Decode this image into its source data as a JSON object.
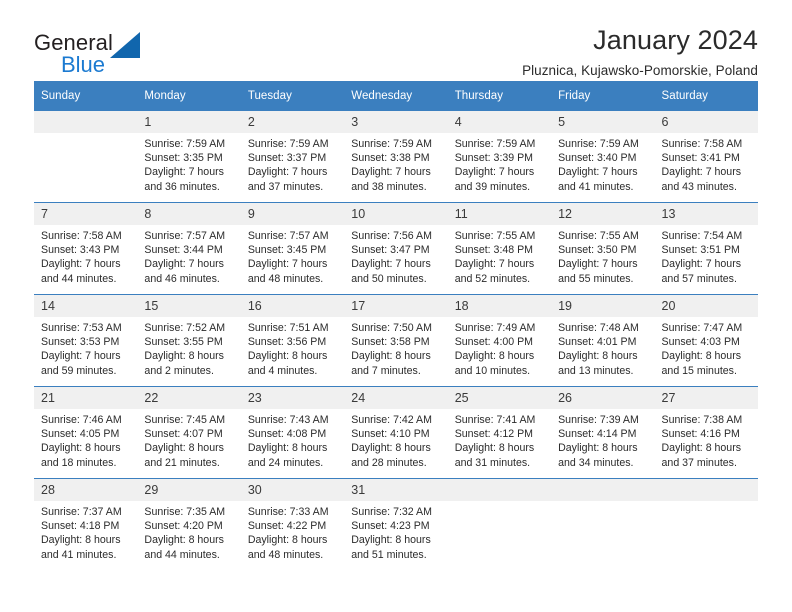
{
  "logo": {
    "word_general": "General",
    "word_blue": "Blue",
    "triangle_color": "#1166ad",
    "blue_text_color": "#1b7ad1"
  },
  "header": {
    "title": "January 2024",
    "subtitle": "Pluznica, Kujawsko-Pomorskie, Poland",
    "header_bg_color": "#3b7fbf",
    "daynum_bg_color": "#f0f0f0"
  },
  "weekday_headers": [
    "Sunday",
    "Monday",
    "Tuesday",
    "Wednesday",
    "Thursday",
    "Friday",
    "Saturday"
  ],
  "labels": {
    "sunrise_prefix": "Sunrise:",
    "sunset_prefix": "Sunset:",
    "daylight_prefix": "Daylight:"
  },
  "weeks": [
    [
      {
        "day": "",
        "blank": true,
        "line1": "",
        "line2": "",
        "line3": "",
        "line4": ""
      },
      {
        "day": "1",
        "line1": "Sunrise: 7:59 AM",
        "line2": "Sunset: 3:35 PM",
        "line3": "Daylight: 7 hours",
        "line4": "and 36 minutes."
      },
      {
        "day": "2",
        "line1": "Sunrise: 7:59 AM",
        "line2": "Sunset: 3:37 PM",
        "line3": "Daylight: 7 hours",
        "line4": "and 37 minutes."
      },
      {
        "day": "3",
        "line1": "Sunrise: 7:59 AM",
        "line2": "Sunset: 3:38 PM",
        "line3": "Daylight: 7 hours",
        "line4": "and 38 minutes."
      },
      {
        "day": "4",
        "line1": "Sunrise: 7:59 AM",
        "line2": "Sunset: 3:39 PM",
        "line3": "Daylight: 7 hours",
        "line4": "and 39 minutes."
      },
      {
        "day": "5",
        "line1": "Sunrise: 7:59 AM",
        "line2": "Sunset: 3:40 PM",
        "line3": "Daylight: 7 hours",
        "line4": "and 41 minutes."
      },
      {
        "day": "6",
        "line1": "Sunrise: 7:58 AM",
        "line2": "Sunset: 3:41 PM",
        "line3": "Daylight: 7 hours",
        "line4": "and 43 minutes."
      }
    ],
    [
      {
        "day": "7",
        "line1": "Sunrise: 7:58 AM",
        "line2": "Sunset: 3:43 PM",
        "line3": "Daylight: 7 hours",
        "line4": "and 44 minutes."
      },
      {
        "day": "8",
        "line1": "Sunrise: 7:57 AM",
        "line2": "Sunset: 3:44 PM",
        "line3": "Daylight: 7 hours",
        "line4": "and 46 minutes."
      },
      {
        "day": "9",
        "line1": "Sunrise: 7:57 AM",
        "line2": "Sunset: 3:45 PM",
        "line3": "Daylight: 7 hours",
        "line4": "and 48 minutes."
      },
      {
        "day": "10",
        "line1": "Sunrise: 7:56 AM",
        "line2": "Sunset: 3:47 PM",
        "line3": "Daylight: 7 hours",
        "line4": "and 50 minutes."
      },
      {
        "day": "11",
        "line1": "Sunrise: 7:55 AM",
        "line2": "Sunset: 3:48 PM",
        "line3": "Daylight: 7 hours",
        "line4": "and 52 minutes."
      },
      {
        "day": "12",
        "line1": "Sunrise: 7:55 AM",
        "line2": "Sunset: 3:50 PM",
        "line3": "Daylight: 7 hours",
        "line4": "and 55 minutes."
      },
      {
        "day": "13",
        "line1": "Sunrise: 7:54 AM",
        "line2": "Sunset: 3:51 PM",
        "line3": "Daylight: 7 hours",
        "line4": "and 57 minutes."
      }
    ],
    [
      {
        "day": "14",
        "line1": "Sunrise: 7:53 AM",
        "line2": "Sunset: 3:53 PM",
        "line3": "Daylight: 7 hours",
        "line4": "and 59 minutes."
      },
      {
        "day": "15",
        "line1": "Sunrise: 7:52 AM",
        "line2": "Sunset: 3:55 PM",
        "line3": "Daylight: 8 hours",
        "line4": "and 2 minutes."
      },
      {
        "day": "16",
        "line1": "Sunrise: 7:51 AM",
        "line2": "Sunset: 3:56 PM",
        "line3": "Daylight: 8 hours",
        "line4": "and 4 minutes."
      },
      {
        "day": "17",
        "line1": "Sunrise: 7:50 AM",
        "line2": "Sunset: 3:58 PM",
        "line3": "Daylight: 8 hours",
        "line4": "and 7 minutes."
      },
      {
        "day": "18",
        "line1": "Sunrise: 7:49 AM",
        "line2": "Sunset: 4:00 PM",
        "line3": "Daylight: 8 hours",
        "line4": "and 10 minutes."
      },
      {
        "day": "19",
        "line1": "Sunrise: 7:48 AM",
        "line2": "Sunset: 4:01 PM",
        "line3": "Daylight: 8 hours",
        "line4": "and 13 minutes."
      },
      {
        "day": "20",
        "line1": "Sunrise: 7:47 AM",
        "line2": "Sunset: 4:03 PM",
        "line3": "Daylight: 8 hours",
        "line4": "and 15 minutes."
      }
    ],
    [
      {
        "day": "21",
        "line1": "Sunrise: 7:46 AM",
        "line2": "Sunset: 4:05 PM",
        "line3": "Daylight: 8 hours",
        "line4": "and 18 minutes."
      },
      {
        "day": "22",
        "line1": "Sunrise: 7:45 AM",
        "line2": "Sunset: 4:07 PM",
        "line3": "Daylight: 8 hours",
        "line4": "and 21 minutes."
      },
      {
        "day": "23",
        "line1": "Sunrise: 7:43 AM",
        "line2": "Sunset: 4:08 PM",
        "line3": "Daylight: 8 hours",
        "line4": "and 24 minutes."
      },
      {
        "day": "24",
        "line1": "Sunrise: 7:42 AM",
        "line2": "Sunset: 4:10 PM",
        "line3": "Daylight: 8 hours",
        "line4": "and 28 minutes."
      },
      {
        "day": "25",
        "line1": "Sunrise: 7:41 AM",
        "line2": "Sunset: 4:12 PM",
        "line3": "Daylight: 8 hours",
        "line4": "and 31 minutes."
      },
      {
        "day": "26",
        "line1": "Sunrise: 7:39 AM",
        "line2": "Sunset: 4:14 PM",
        "line3": "Daylight: 8 hours",
        "line4": "and 34 minutes."
      },
      {
        "day": "27",
        "line1": "Sunrise: 7:38 AM",
        "line2": "Sunset: 4:16 PM",
        "line3": "Daylight: 8 hours",
        "line4": "and 37 minutes."
      }
    ],
    [
      {
        "day": "28",
        "line1": "Sunrise: 7:37 AM",
        "line2": "Sunset: 4:18 PM",
        "line3": "Daylight: 8 hours",
        "line4": "and 41 minutes."
      },
      {
        "day": "29",
        "line1": "Sunrise: 7:35 AM",
        "line2": "Sunset: 4:20 PM",
        "line3": "Daylight: 8 hours",
        "line4": "and 44 minutes."
      },
      {
        "day": "30",
        "line1": "Sunrise: 7:33 AM",
        "line2": "Sunset: 4:22 PM",
        "line3": "Daylight: 8 hours",
        "line4": "and 48 minutes."
      },
      {
        "day": "31",
        "line1": "Sunrise: 7:32 AM",
        "line2": "Sunset: 4:23 PM",
        "line3": "Daylight: 8 hours",
        "line4": "and 51 minutes."
      },
      {
        "day": "",
        "blank": true,
        "line1": "",
        "line2": "",
        "line3": "",
        "line4": ""
      },
      {
        "day": "",
        "blank": true,
        "line1": "",
        "line2": "",
        "line3": "",
        "line4": ""
      },
      {
        "day": "",
        "blank": true,
        "line1": "",
        "line2": "",
        "line3": "",
        "line4": ""
      }
    ]
  ]
}
